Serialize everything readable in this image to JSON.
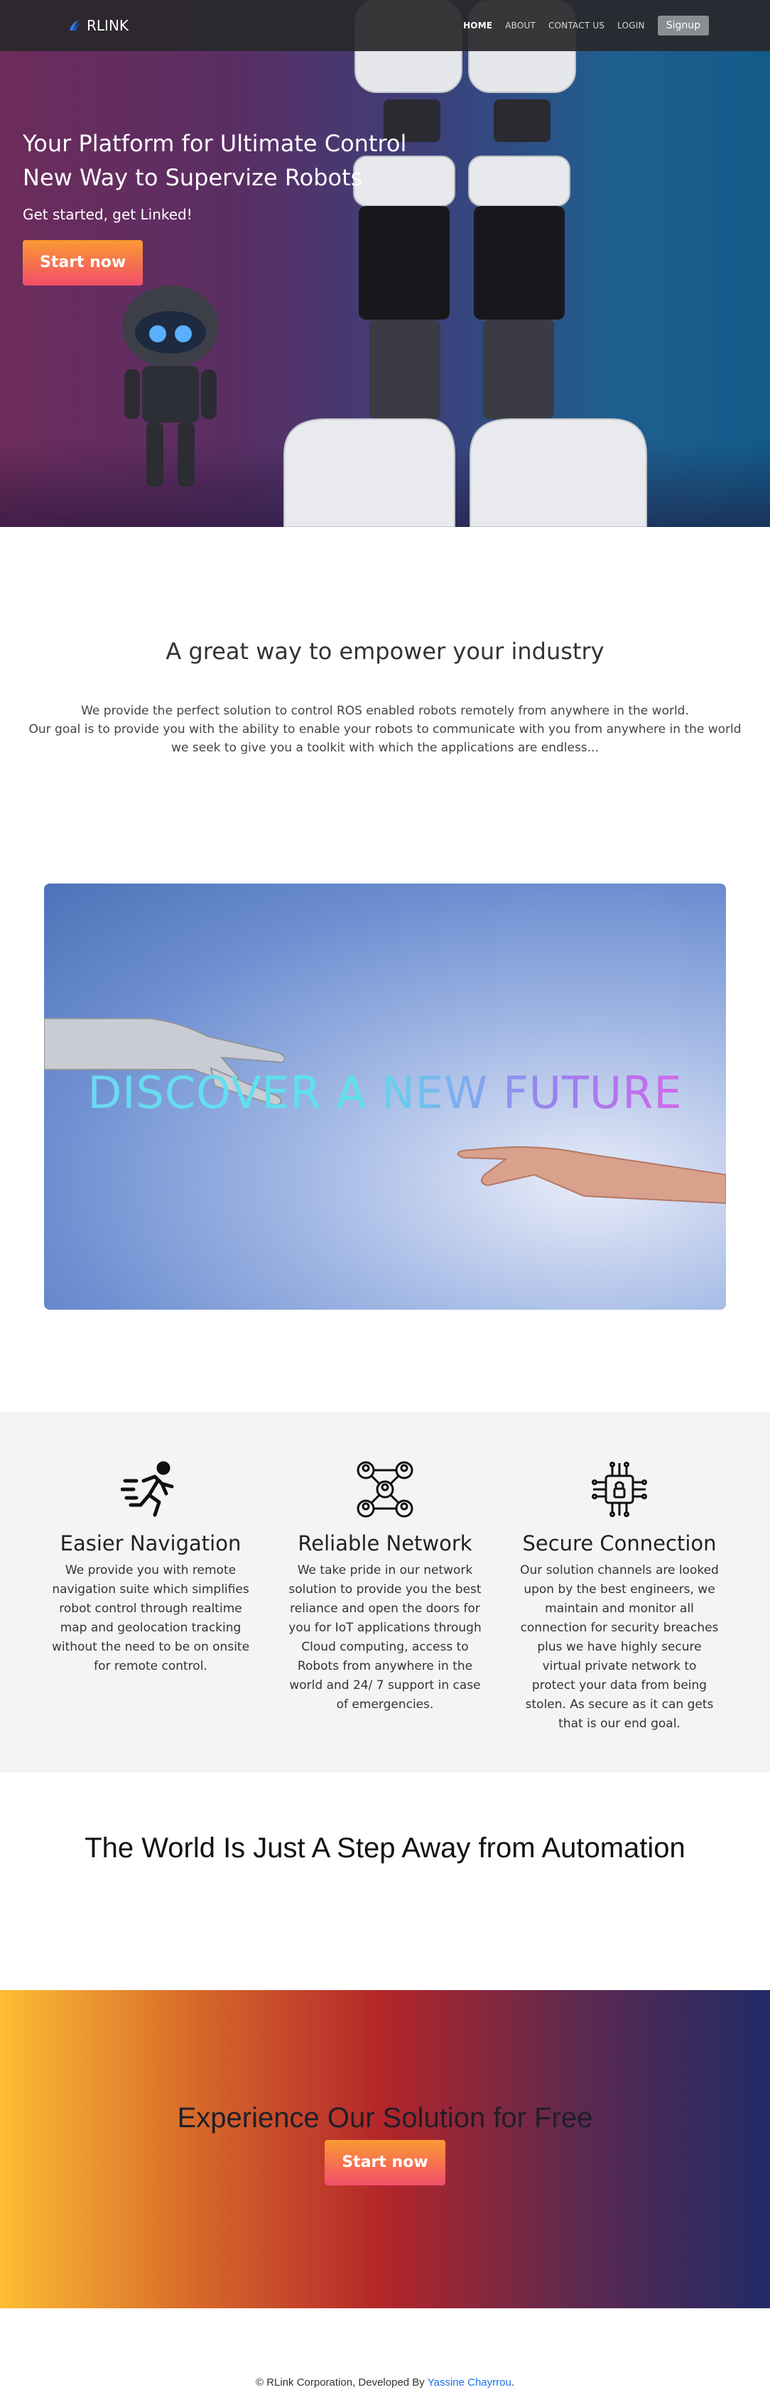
{
  "nav": {
    "brand": "RLINK",
    "links": [
      "HOME",
      "ABOUT",
      "CONTACT US",
      "LOGIN"
    ],
    "signup": "Signup"
  },
  "hero": {
    "title_line1": "Your Platform for Ultimate Control",
    "title_line2": "New Way to Supervize Robots",
    "subtitle": "Get started, get Linked!",
    "cta": "Start now"
  },
  "intro": {
    "title": "A great way to empower your industry",
    "line1": "We provide the perfect solution to control ROS enabled robots remotely from anywhere in the world.",
    "line2": "Our goal is to provide you with the ability to enable your robots to communicate with you from anywhere in the world",
    "line3": "we seek to give you a toolkit with which the applications are endless..."
  },
  "discover": {
    "text": "DISCOVER A NEW FUTURE"
  },
  "features": [
    {
      "icon": "running-person-icon",
      "title": "Easier Navigation",
      "text": "We provide you with remote navigation suite which simplifies robot control through realtime map and geolocation tracking without the need to be on onsite for remote control."
    },
    {
      "icon": "network-people-icon",
      "title": "Reliable Network",
      "text": "We take pride in our network solution to provide you the best reliance and open the doors for you for IoT applications through Cloud computing, access to Robots from anywhere in the world and 24/ 7 support in case of emergencies."
    },
    {
      "icon": "secure-chip-icon",
      "title": "Secure Connection",
      "text": "Our solution channels are looked upon by the best engineers, we maintain and monitor all connection for security breaches plus we have highly secure virtual private network to protect your data from being stolen. As secure as it can gets that is our end goal."
    }
  ],
  "automation": {
    "title": "The World Is Just A Step Away from Automation"
  },
  "cta": {
    "title": "Experience Our Solution for Free",
    "button": "Start now"
  },
  "footer": {
    "prefix": "© RLink Corporation, Developed By ",
    "author": "Yassine Chayrrou",
    "suffix": "."
  }
}
